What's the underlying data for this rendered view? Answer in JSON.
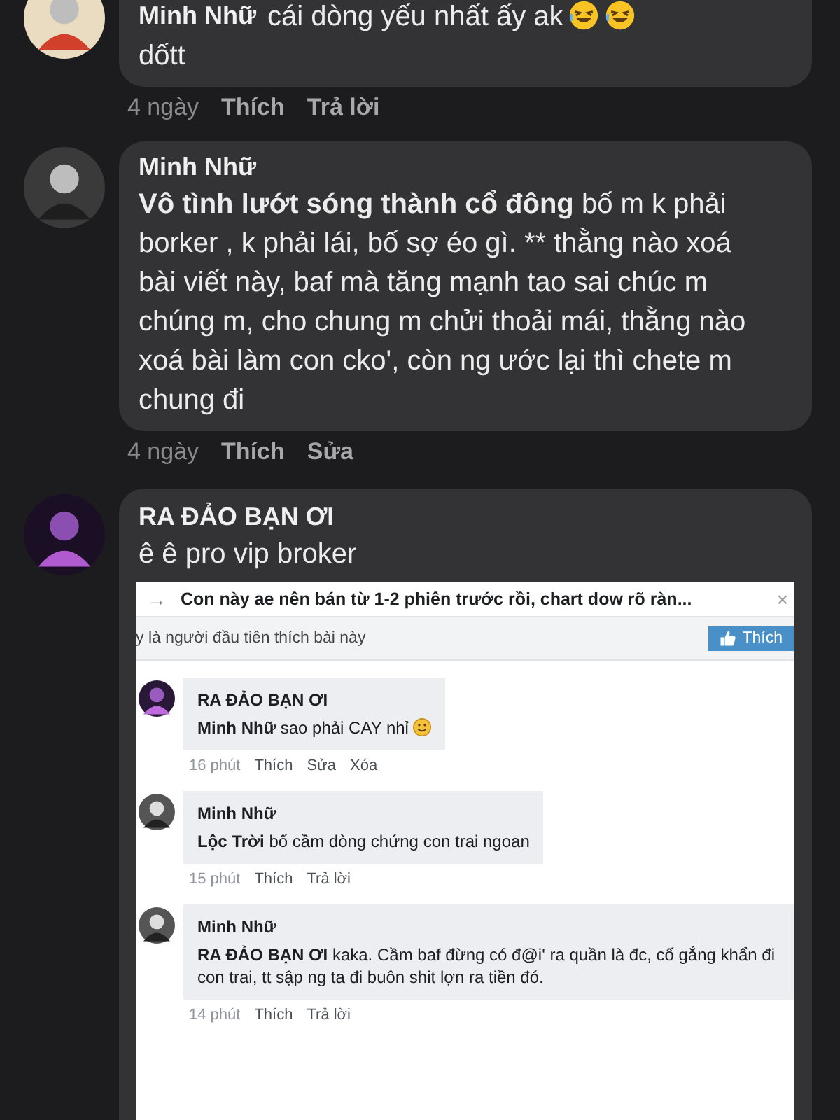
{
  "comments": [
    {
      "author": "Minh Nhữ",
      "parts": [
        {
          "kind": "text",
          "text": "cái dòng yếu nhất ấy ak"
        },
        {
          "kind": "laugh"
        },
        {
          "kind": "laugh"
        },
        {
          "kind": "break"
        },
        {
          "kind": "text",
          "text": "dốtt"
        }
      ],
      "time": "4 ngày",
      "actions": [
        "Thích",
        "Trả lời"
      ]
    },
    {
      "author": "Minh Nhữ",
      "parts": [
        {
          "kind": "text",
          "text": "**Vô tình lướt sóng thành cổ đông**   bố m k phải borker , k phải lái, bố sợ éo gì. ** thằng nào xoá bài viết này, baf mà tăng mạnh tao sai chúc m chúng m, cho chung m chửi thoải mái, thằng nào xoá bài làm con cko', còn ng ước lại thì chete m chung đi"
        }
      ],
      "time": "4 ngày",
      "actions": [
        "Thích",
        "Sửa"
      ]
    },
    {
      "author": "RA ĐẢO BẠN ƠI",
      "parts": [
        {
          "kind": "text",
          "text": "ê ê pro vip broker"
        }
      ],
      "attachment": {
        "kind": "screenshot",
        "arrow": "→",
        "title": "Con này ae nên bán từ 1-2 phiên trước rồi, chart dow rõ ràn...",
        "close": "×",
        "likes_text": "y là người đầu tiên thích bài này",
        "like_button": "Thích",
        "comments": [
          {
            "author": "RA ĐẢO BẠN ƠI",
            "parts": [
              {
                "kind": "text",
                "text": "**Minh Nhữ** sao phải CAY nhỉ"
              },
              {
                "kind": "smile"
              }
            ],
            "time": "16 phút",
            "actions": [
              "Thích",
              "Sửa",
              "Xóa"
            ]
          },
          {
            "author": "Minh Nhữ",
            "parts": [
              {
                "kind": "text",
                "text": "**Lộc Trời**  bố cầm dòng chứng con trai ngoan"
              }
            ],
            "time": "15 phút",
            "actions": [
              "Thích",
              "Trả lời"
            ]
          },
          {
            "author": "Minh Nhữ",
            "parts": [
              {
                "kind": "text",
                "text": "**RA ĐẢO BẠN ƠI** kaka. Cầm baf đừng có đ@i' ra quần là đc, cố gắng khẩn đi con trai, tt sập ng ta đi buôn shit lợn ra tiền đó."
              }
            ],
            "time": "14 phút",
            "actions": [
              "Thích",
              "Trả lời"
            ]
          }
        ]
      }
    }
  ]
}
